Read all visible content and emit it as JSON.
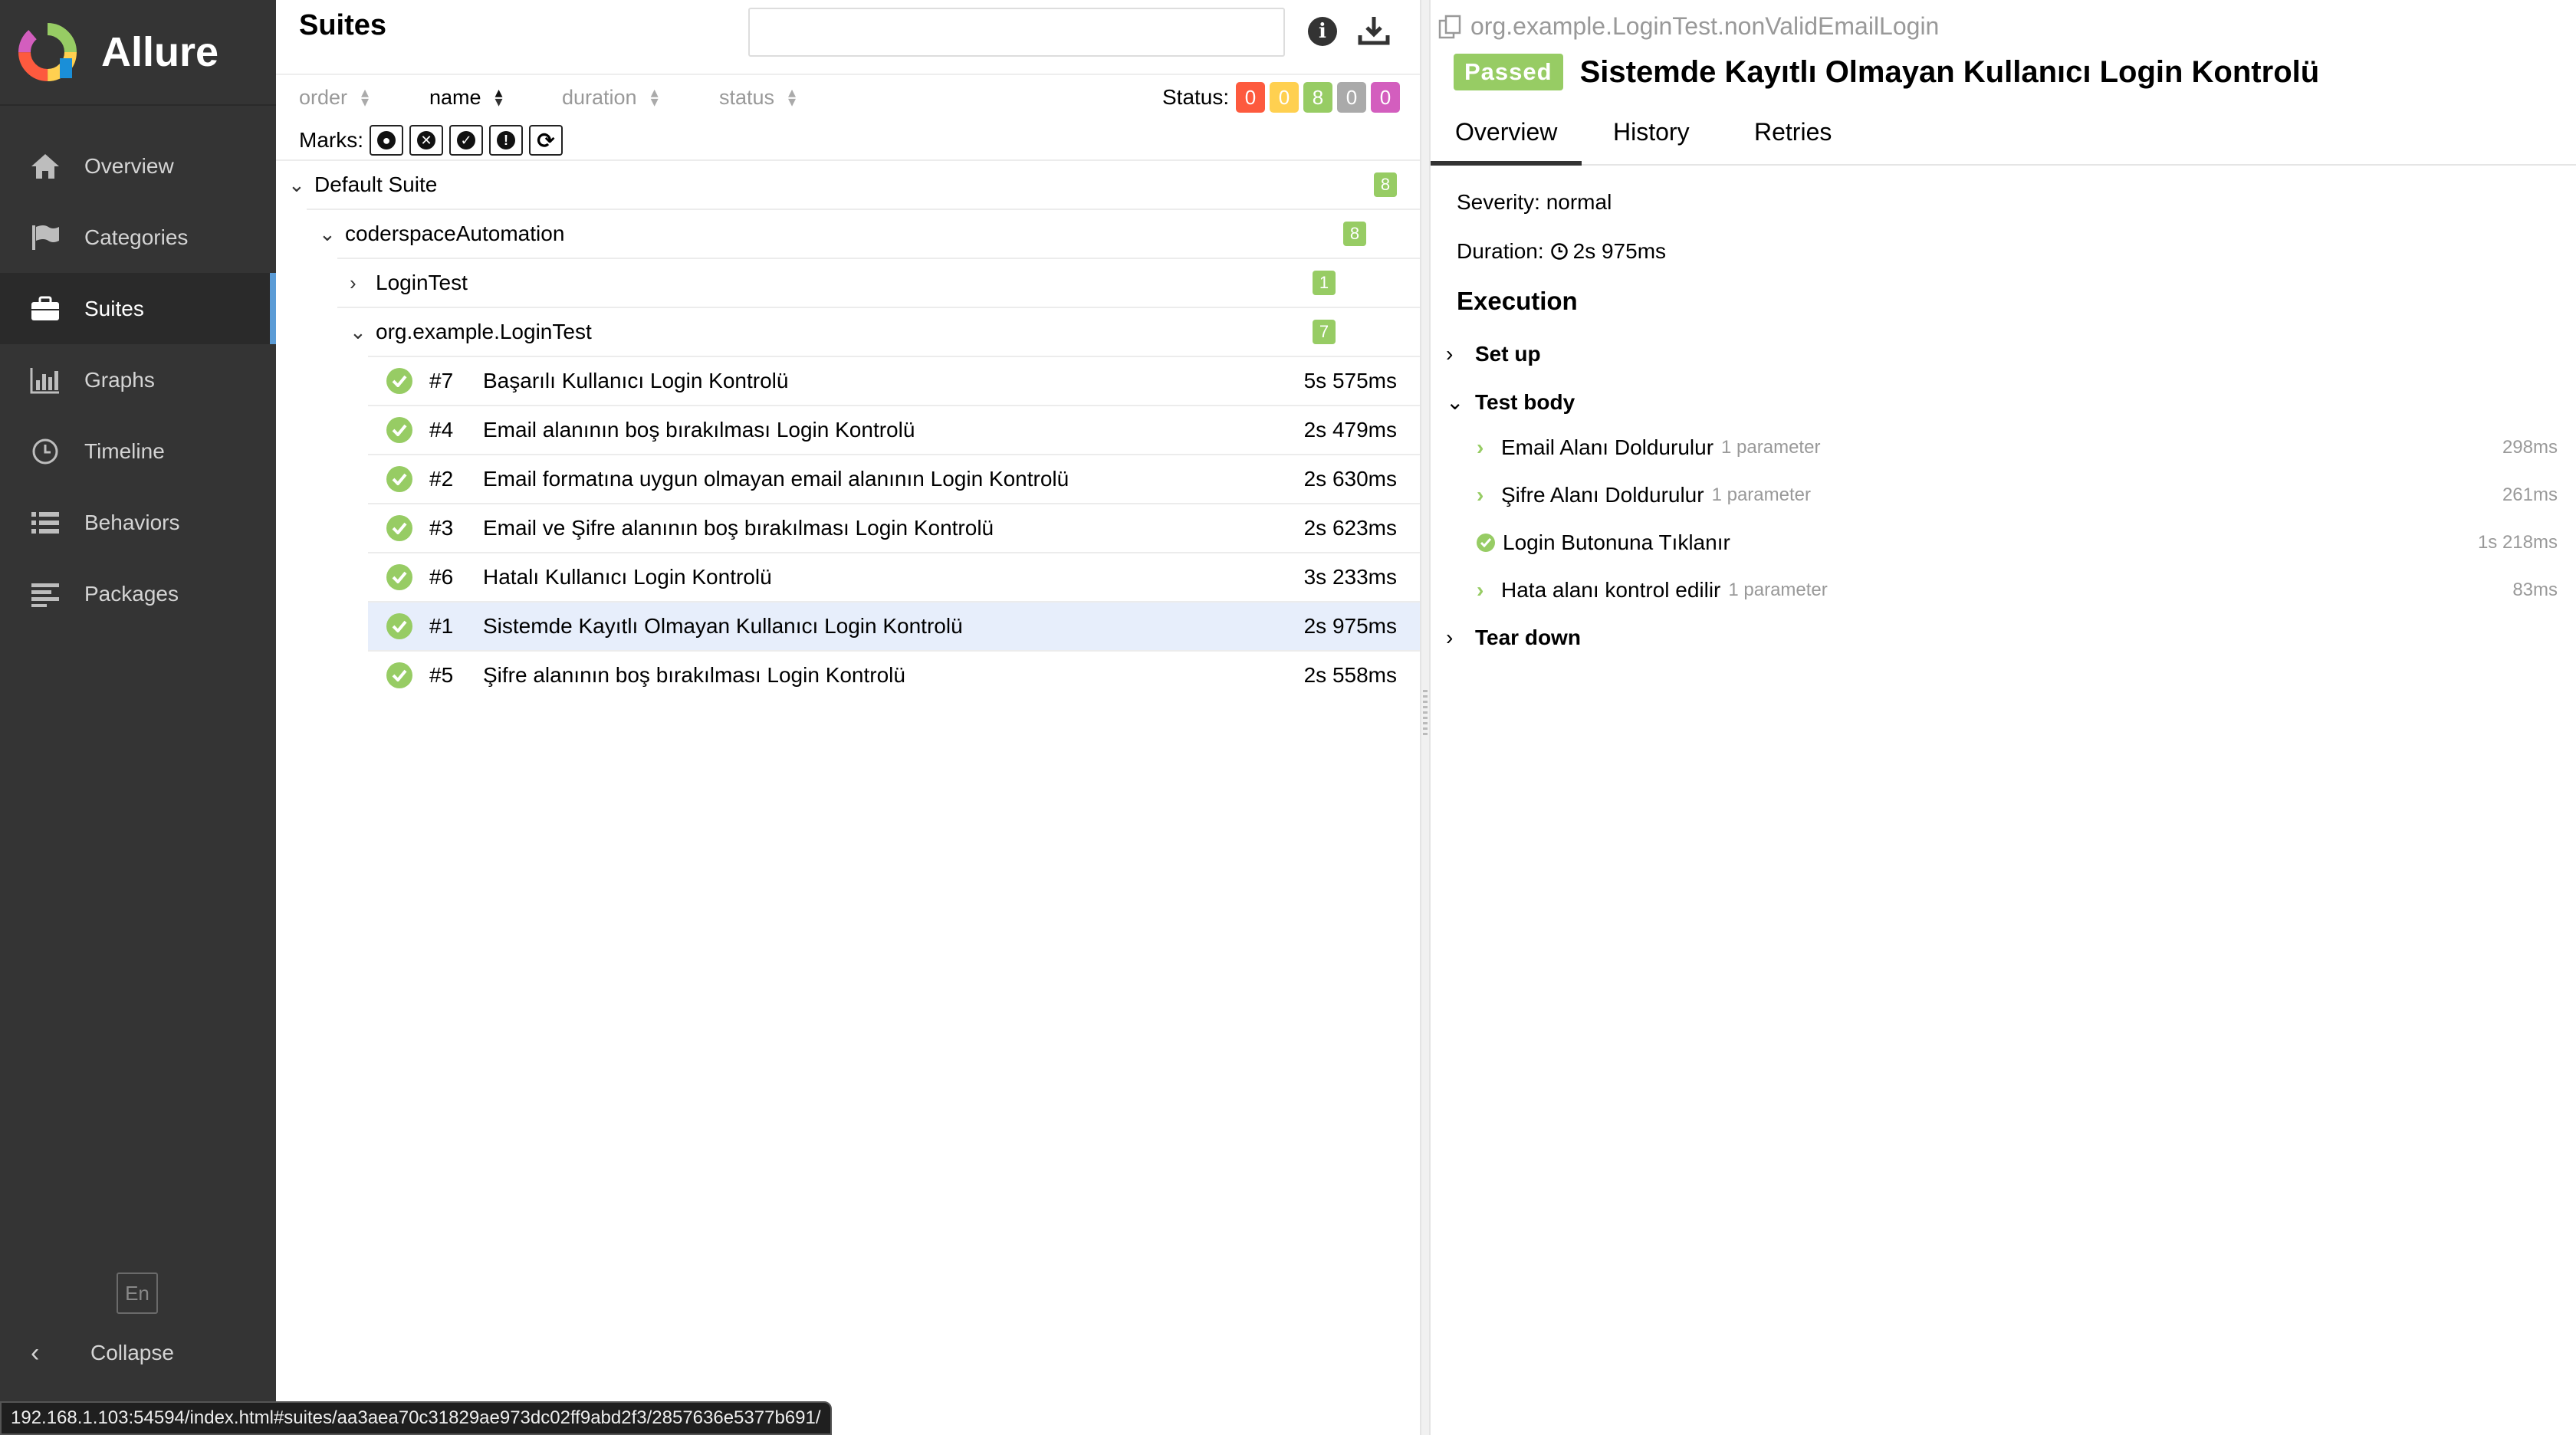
{
  "sidebar": {
    "brand": "Allure",
    "items": [
      {
        "label": "Overview",
        "icon": "home-icon",
        "active": false
      },
      {
        "label": "Categories",
        "icon": "flag-icon",
        "active": false
      },
      {
        "label": "Suites",
        "icon": "briefcase-icon",
        "active": true
      },
      {
        "label": "Graphs",
        "icon": "bar-chart-icon",
        "active": false
      },
      {
        "label": "Timeline",
        "icon": "clock-icon",
        "active": false
      },
      {
        "label": "Behaviors",
        "icon": "list-icon",
        "active": false
      },
      {
        "label": "Packages",
        "icon": "align-left-icon",
        "active": false
      }
    ],
    "language": "En",
    "collapse_label": "Collapse"
  },
  "suites": {
    "title": "Suites",
    "search_placeholder": "",
    "sort": {
      "order": "order",
      "name": "name",
      "duration": "duration",
      "status": "status"
    },
    "status_label": "Status:",
    "status_counts": [
      {
        "value": "0",
        "color": "#fd5a3e"
      },
      {
        "value": "0",
        "color": "#ffd050"
      },
      {
        "value": "8",
        "color": "#97cc64"
      },
      {
        "value": "0",
        "color": "#aaaaaa"
      },
      {
        "value": "0",
        "color": "#d35ebe"
      }
    ],
    "marks_label": "Marks:",
    "tree": {
      "default_suite": {
        "label": "Default Suite",
        "count": "8"
      },
      "coderspace": {
        "label": "coderspaceAutomation",
        "count": "8"
      },
      "login_test": {
        "label": "LoginTest",
        "count": "1"
      },
      "org_login_test": {
        "label": "org.example.LoginTest",
        "count": "7"
      }
    },
    "tests": [
      {
        "num": "#7",
        "name": "Başarılı Kullanıcı Login Kontrolü",
        "duration": "5s 575ms"
      },
      {
        "num": "#4",
        "name": "Email alanının boş bırakılması Login Kontrolü",
        "duration": "2s 479ms"
      },
      {
        "num": "#2",
        "name": "Email formatına uygun olmayan email alanının Login Kontrolü",
        "duration": "2s 630ms"
      },
      {
        "num": "#3",
        "name": "Email ve Şifre alanının boş bırakılması Login Kontrolü",
        "duration": "2s 623ms"
      },
      {
        "num": "#6",
        "name": "Hatalı Kullanıcı Login Kontrolü",
        "duration": "3s 233ms"
      },
      {
        "num": "#1",
        "name": "Sistemde Kayıtlı Olmayan Kullanıcı Login Kontrolü",
        "duration": "2s 975ms"
      },
      {
        "num": "#5",
        "name": "Şifre alanının boş bırakılması Login Kontrolü",
        "duration": "2s 558ms"
      }
    ]
  },
  "detail": {
    "full_name": "org.example.LoginTest.nonValidEmailLogin",
    "status": "Passed",
    "title": "Sistemde Kayıtlı Olmayan Kullanıcı Login Kontrolü",
    "tabs": [
      "Overview",
      "History",
      "Retries"
    ],
    "severity": "Severity: normal",
    "duration_label": "Duration:",
    "duration": "2s 975ms",
    "execution_heading": "Execution",
    "setup": "Set up",
    "test_body": "Test body",
    "teardown": "Tear down",
    "steps": [
      {
        "name": "Email Alanı Doldurulur",
        "param": "1 parameter",
        "duration": "298ms"
      },
      {
        "name": "Şifre Alanı Doldurulur",
        "param": "1 parameter",
        "duration": "261ms"
      },
      {
        "name": "Login Butonuna Tıklanır",
        "param": "",
        "duration": "1s 218ms"
      },
      {
        "name": "Hata alanı kontrol edilir",
        "param": "1 parameter",
        "duration": "83ms"
      }
    ]
  },
  "status_bar_url": "192.168.1.103:54594/index.html#suites/aa3aea70c31829ae973dc02ff9abd2f3/2857636e5377b691/"
}
